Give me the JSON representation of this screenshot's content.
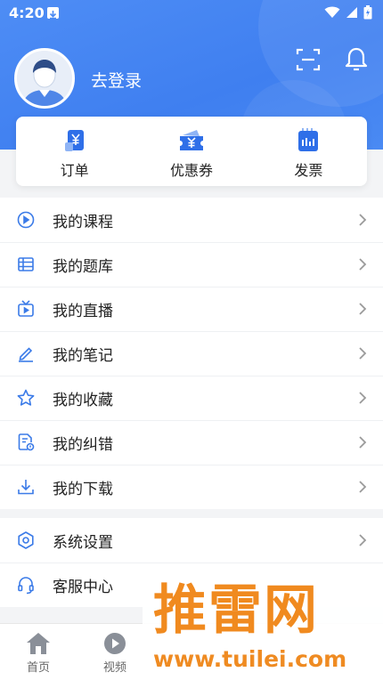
{
  "status_bar": {
    "time": "4:20"
  },
  "profile": {
    "login_label": "去登录"
  },
  "quick": [
    {
      "label": "订单",
      "icon": "receipt-icon"
    },
    {
      "label": "优惠券",
      "icon": "coupon-icon"
    },
    {
      "label": "发票",
      "icon": "invoice-icon"
    }
  ],
  "menu1": [
    {
      "label": "我的课程",
      "icon": "play-circle-icon"
    },
    {
      "label": "我的题库",
      "icon": "question-bank-icon"
    },
    {
      "label": "我的直播",
      "icon": "tv-live-icon"
    },
    {
      "label": "我的笔记",
      "icon": "pencil-icon"
    },
    {
      "label": "我的收藏",
      "icon": "star-icon"
    },
    {
      "label": "我的纠错",
      "icon": "error-report-icon"
    },
    {
      "label": "我的下载",
      "icon": "download-icon"
    }
  ],
  "menu2": [
    {
      "label": "系统设置",
      "icon": "gear-icon"
    },
    {
      "label": "客服中心",
      "icon": "headset-icon"
    }
  ],
  "tabs": [
    {
      "label": "首页",
      "icon": "home-icon"
    },
    {
      "label": "视频",
      "icon": "video-icon"
    }
  ],
  "watermark": {
    "big": "推雷网",
    "small": "www.tuilei.com"
  },
  "colors": {
    "header": "#4a8af3",
    "accent": "#3b82f6",
    "watermark": "#f08a1f"
  }
}
